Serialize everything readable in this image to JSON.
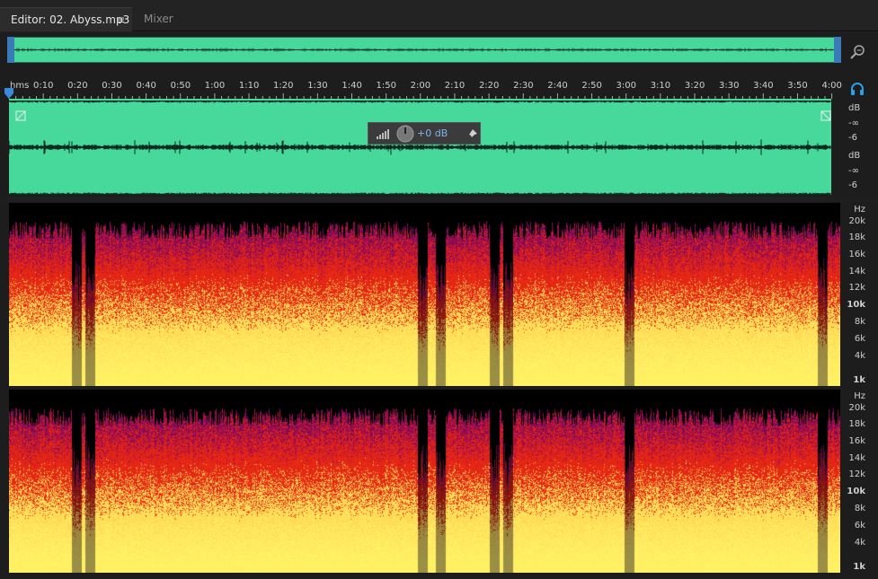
{
  "tabs": {
    "editor_label": "Editor: 02. Abyss.mp3",
    "menu_icon": "≡",
    "mixer_label": "Mixer"
  },
  "ruler": {
    "unit": "hms",
    "ticks": [
      "0:10",
      "0:20",
      "0:30",
      "0:40",
      "0:50",
      "1:00",
      "1:10",
      "1:20",
      "1:30",
      "1:40",
      "1:50",
      "2:00",
      "2:10",
      "2:20",
      "2:30",
      "2:40",
      "2:50",
      "3:00",
      "3:10",
      "3:20",
      "3:30",
      "3:40",
      "3:50",
      "4:00"
    ]
  },
  "amplitude": {
    "db": "dB",
    "inf": "-∞",
    "six": "-6"
  },
  "hud": {
    "gain": "+0 dB"
  },
  "frequency": {
    "unit": "Hz",
    "labels": [
      "20k",
      "18k",
      "16k",
      "14k",
      "12k",
      "10k",
      "8k",
      "6k",
      "4k",
      "1k"
    ]
  },
  "colors": {
    "waveform": "#47d89b",
    "accent": "#3a7ab8",
    "headphone": "#2aa0e8"
  }
}
